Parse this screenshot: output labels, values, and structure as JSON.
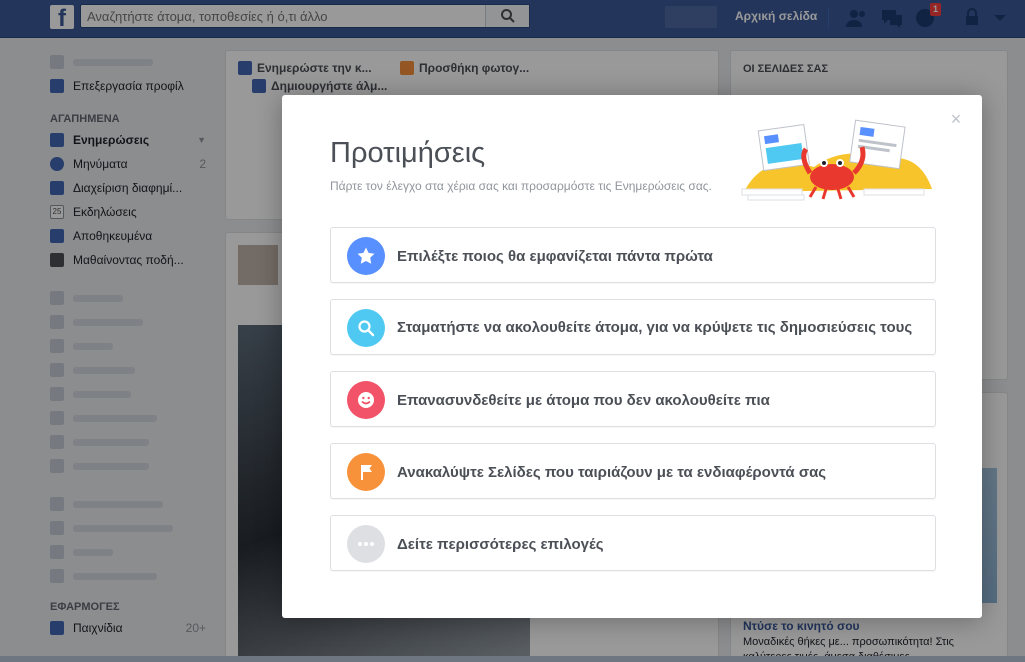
{
  "topbar": {
    "logo": "f",
    "search_placeholder": "Αναζητήστε άτομα, τοποθεσίες ή ό,τι άλλο",
    "home_label": "Αρχική σελίδα",
    "notification_count": "1"
  },
  "sidebar": {
    "edit_profile": "Επεξεργασία προφίλ",
    "favorites_header": "ΑΓΑΠΗΜΕΝΑ",
    "favorites": [
      {
        "label": "Ενημερώσεις",
        "count": ""
      },
      {
        "label": "Μηνύματα",
        "count": "2"
      },
      {
        "label": "Διαχείριση διαφημί...",
        "count": ""
      },
      {
        "label": "Εκδηλώσεις",
        "count": ""
      },
      {
        "label": "Αποθηκευμένα",
        "count": ""
      },
      {
        "label": "Μαθαίνοντας ποδή...",
        "count": ""
      }
    ],
    "apps_header": "ΕΦΑΡΜΟΓΕΣ",
    "apps": [
      {
        "label": "Παιχνίδια",
        "count": "20+"
      }
    ],
    "events_day": "25"
  },
  "composer": {
    "tab_update": "Ενημερώστε την κ...",
    "tab_photo": "Προσθήκη φωτογ...",
    "tab_album": "Δημιουργήστε άλμ..."
  },
  "right": {
    "pages_header": "ΟΙ ΣΕΛΙΔΕΣ ΣΑΣ",
    "ad_title": "Ντύσε το κινητό σου",
    "ad_text": "Μοναδικές θήκες με... προσωπικότητα! Στις καλύτερες τιμές, άμεσα διαθέσιμες"
  },
  "modal": {
    "title": "Προτιμήσεις",
    "subtitle": "Πάρτε τον έλεγχο στα χέρια σας και προσαρμόστε τις Ενημερώσεις σας.",
    "close": "×",
    "options": [
      {
        "label": "Επιλέξτε ποιος θα εμφανίζεται πάντα πρώτα",
        "icon": "star-icon",
        "color": "#5890ff"
      },
      {
        "label": "Σταματήστε να ακολουθείτε άτομα, για να κρύψετε τις δημοσιεύσεις τους",
        "icon": "search-icon",
        "color": "#4fc9f1"
      },
      {
        "label": "Επανασυνδεθείτε με άτομα που δεν ακολουθείτε πια",
        "icon": "smile-icon",
        "color": "#f35369"
      },
      {
        "label": "Ανακαλύψτε Σελίδες που ταιριάζουν με τα ενδιαφέροντά σας",
        "icon": "flag-icon",
        "color": "#f7923b"
      },
      {
        "label": "Δείτε περισσότερες επιλογές",
        "icon": "more-icon",
        "color": "#dddfe2"
      }
    ]
  }
}
